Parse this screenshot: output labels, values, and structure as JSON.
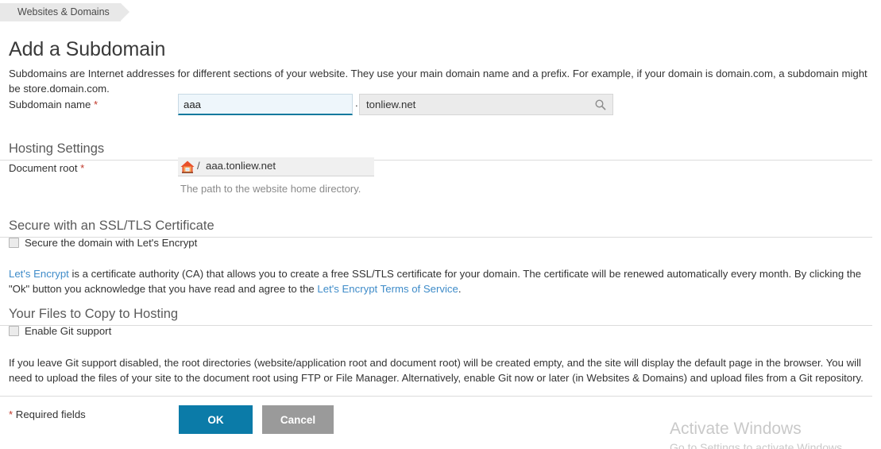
{
  "breadcrumb": {
    "label": "Websites & Domains"
  },
  "page": {
    "title": "Add a Subdomain"
  },
  "intro": {
    "text": "Subdomains are Internet addresses for different sections of your website. They use your main domain name and a prefix. For example, if your domain is domain.com, a subdomain might be store.domain.com."
  },
  "subdomain_field": {
    "label": "Subdomain name",
    "required_marker": "*",
    "value": "aaa",
    "placeholder": "",
    "separator": ".",
    "domain_value": "tonliew.net",
    "search_icon": "search-icon"
  },
  "hosting_section": {
    "header": "Hosting Settings",
    "docroot_label": "Document root",
    "required_marker": "*",
    "home_icon": "home-icon",
    "slash": "/",
    "docroot_value": "aaa.tonliew.net",
    "hint": "The path to the website home directory."
  },
  "ssl_section": {
    "header": "Secure with an SSL/TLS Certificate",
    "checkbox_label": "Secure the domain with Let's Encrypt",
    "checkbox_checked": false,
    "para_link1": "Let's Encrypt",
    "para_part1": " is a certificate authority (CA) that allows you to create a free SSL/TLS certificate for your domain. The certificate will be renewed automatically every month. By clicking the \"Ok\" button you acknowledge that you have read and agree to the ",
    "para_link2": "Let's Encrypt Terms of Service",
    "para_part2": "."
  },
  "git_section": {
    "header": "Your Files to Copy to Hosting",
    "checkbox_label": "Enable Git support",
    "checkbox_checked": false,
    "para": "If you leave Git support disabled, the root directories (website/application root and document root) will be created empty, and the site will display the default page in the browser. You will need to upload the files of your site to the document root using FTP or File Manager. Alternatively, enable Git now or later (in Websites & Domains) and upload files from a Git repository."
  },
  "footer": {
    "required_marker": "*",
    "required_text": " Required fields",
    "ok_label": "OK",
    "cancel_label": "Cancel"
  },
  "watermark": {
    "title": "Activate Windows",
    "subtitle": "Go to Settings to activate Windows."
  },
  "colors": {
    "accent": "#0b7ba8",
    "link": "#3f8cc9",
    "required": "#c0392b",
    "cancel": "#9a9a9a",
    "focus_border": "#10799e"
  }
}
